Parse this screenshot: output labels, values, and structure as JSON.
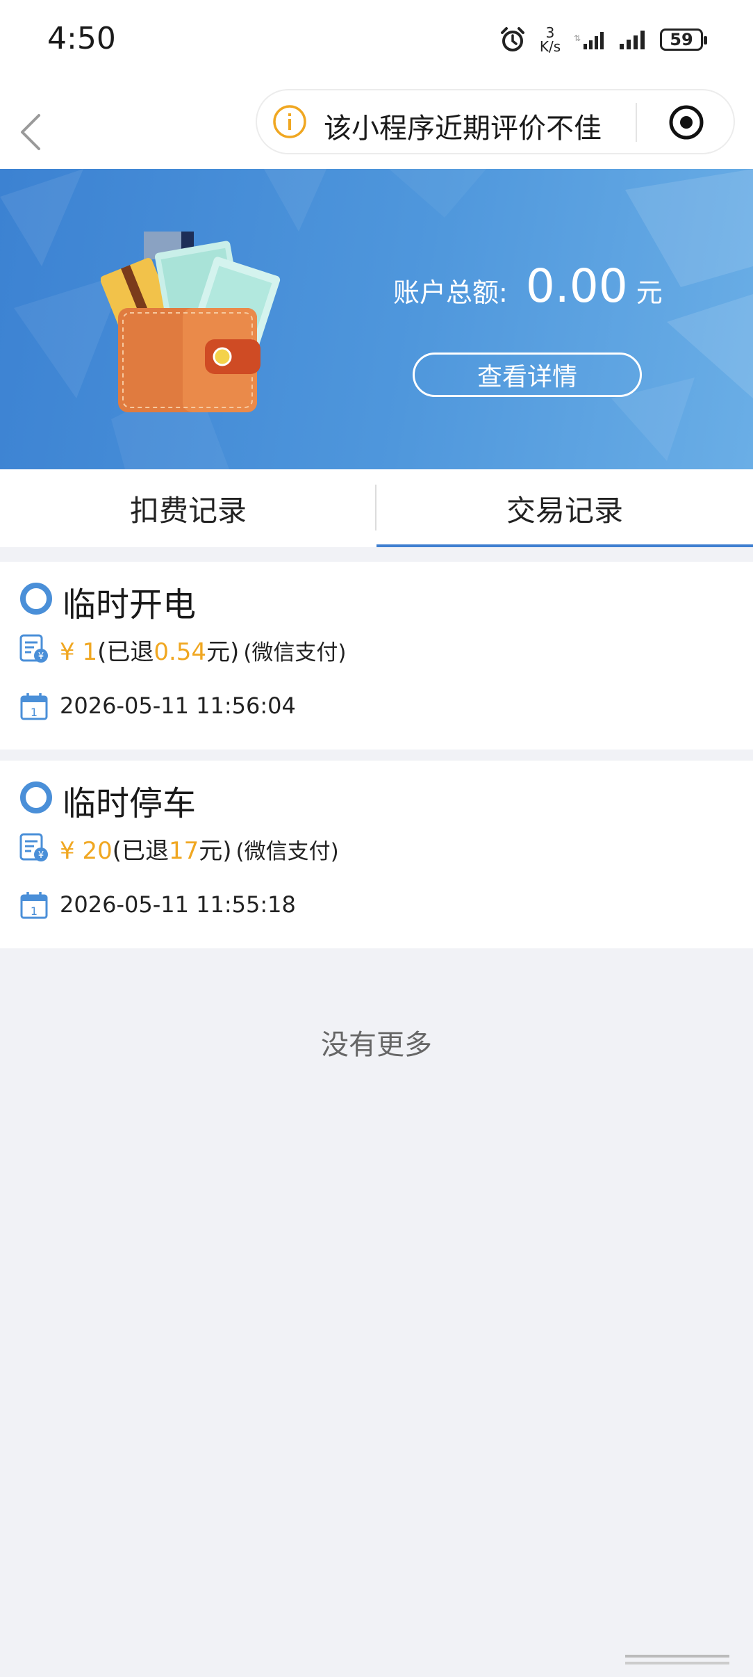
{
  "status_bar": {
    "time": "4:50",
    "net_speed_value": "3",
    "net_speed_unit": "K/s",
    "battery": "59"
  },
  "nav": {
    "rating_notice": "该小程序近期评价不佳"
  },
  "banner": {
    "balance_label": "账户总额:",
    "balance_value": "0.00",
    "balance_unit": "元",
    "detail_button": "查看详情"
  },
  "tabs": [
    {
      "label": "扣费记录",
      "active": false
    },
    {
      "label": "交易记录",
      "active": true
    }
  ],
  "records": [
    {
      "title": "临时开电",
      "currency": "¥",
      "amount": "1",
      "refund_prefix": "(已退",
      "refund_amount": "0.54",
      "refund_suffix": "元)",
      "pay_method": "(微信支付)",
      "time": "2026-05-11 11:56:04"
    },
    {
      "title": "临时停车",
      "currency": "¥",
      "amount": "20",
      "refund_prefix": "(已退",
      "refund_amount": "17",
      "refund_suffix": "元)",
      "pay_method": "(微信支付)",
      "time": "2026-05-11 11:55:18"
    }
  ],
  "footer": {
    "no_more": "没有更多"
  },
  "colors": {
    "accent_blue": "#3f7fd0",
    "amount_gold": "#f0a721",
    "page_bg": "#f1f2f6"
  }
}
